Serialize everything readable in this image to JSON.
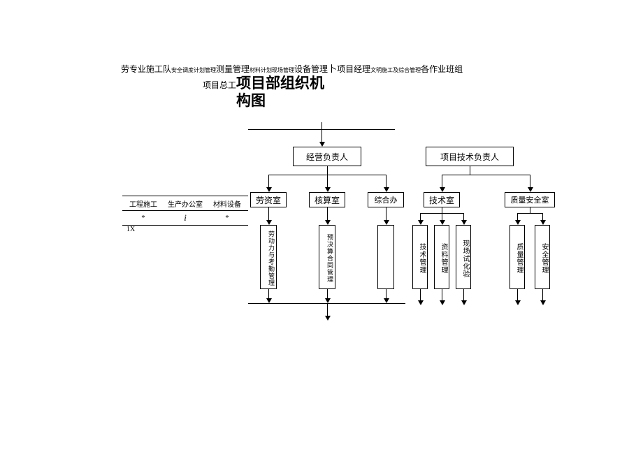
{
  "header": {
    "t1": "劳",
    "t2": "专业施工队",
    "t3": "安全调度计划管理",
    "t4": "测量管理",
    "t5": "材料计划现场管理",
    "t6": "设备管理",
    "t7": "卜",
    "t8": "项目经理",
    "t9": "文明施工及综合管理",
    "t10": "各作业班组"
  },
  "title": {
    "prefix": "项目总工",
    "main1": "项目部组织机",
    "main2": "构图"
  },
  "leftTable": {
    "c1": "工程施工",
    "c2": "生产办公室",
    "c3": "材料设备",
    "r2a": "*",
    "r2b": "i",
    "r2c": "*",
    "r3": "1X"
  },
  "level1": {
    "b1": "经营负责人",
    "b2": "项目技术负责人"
  },
  "level2": {
    "b1": "劳资室",
    "b2": "核算室",
    "b3": "综合办",
    "b4": "技术室",
    "b5": "质量安全室"
  },
  "level3": {
    "b1": "劳动力与考勤管理",
    "b2": "预决算合同管理",
    "b3": "技术管理",
    "b4": "资料管理",
    "b5": "现场试化验",
    "b6": "质量管理",
    "b7": "安全管理"
  }
}
